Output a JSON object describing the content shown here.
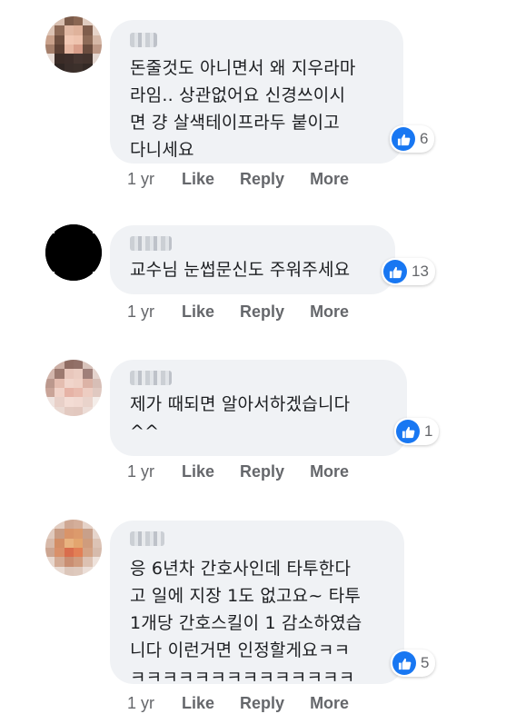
{
  "comments": [
    {
      "text": "돈줄것도 아니면서 왜 지우라마\n라임.. 상관없어요 신경쓰이시\n면 걍 살색테이프라두 붙이고\n다니세요",
      "reaction_count": "6",
      "time": "1 yr"
    },
    {
      "text": "교수님 눈썹문신도 주워주세요",
      "reaction_count": "13",
      "time": "1 yr"
    },
    {
      "text": "제가 때되면 알아서하겠습니다\n^^",
      "reaction_count": "1",
      "time": "1 yr"
    },
    {
      "text": "응 6년차 간호사인데 타투한다\n고 일에 지장 1도 없고요~ 타투\n1개당 간호스킬이 1 감소하였습\n니다 이런거면 인정할게요ㅋㅋ\nㅋㅋㅋㅋㅋㅋㅋㅋㅋㅋㅋㅋㅋㅋ",
      "reaction_count": "5",
      "time": "1 yr"
    }
  ],
  "actions": {
    "like": "Like",
    "reply": "Reply",
    "more": "More"
  },
  "colors": {
    "bubble": "#f0f2f5",
    "like_blue": "#1877f2",
    "meta_text": "#65676b"
  }
}
